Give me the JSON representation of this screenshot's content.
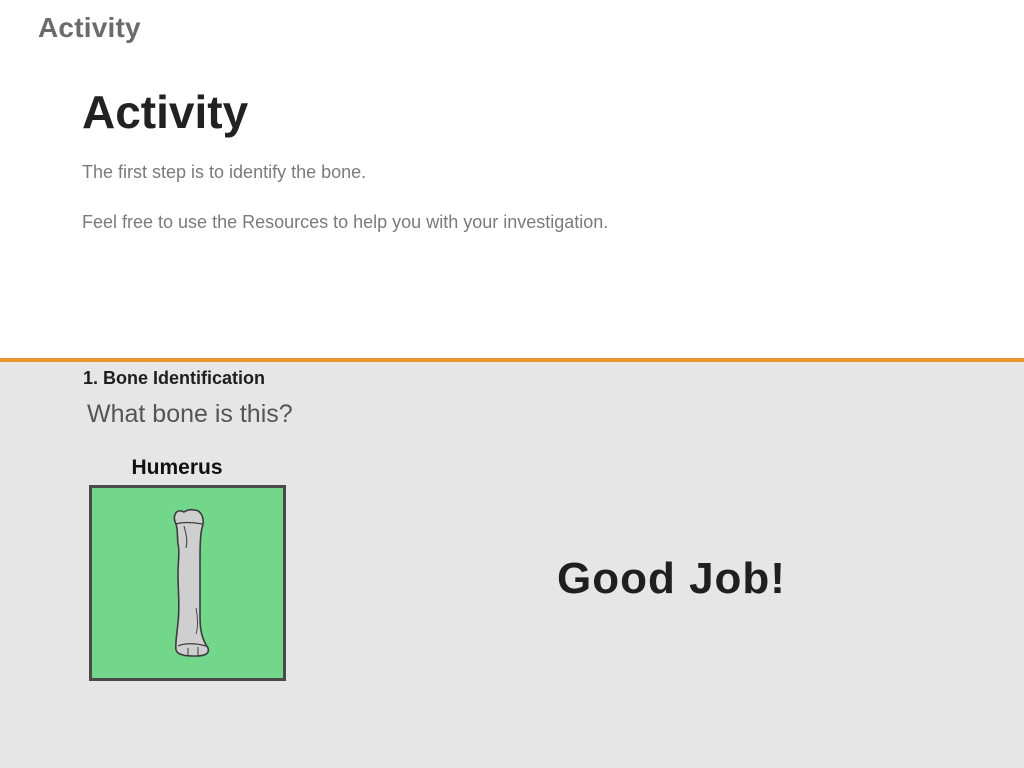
{
  "app": {
    "title": "Activity"
  },
  "intro": {
    "heading": "Activity",
    "paragraphs": [
      "The first step is to identify the bone.",
      "Feel free to use the Resources to help you with your investigation."
    ]
  },
  "question": {
    "header": "1. Bone Identification",
    "prompt": "What bone is this?",
    "selected_answer": {
      "label": "Humerus",
      "icon": "bone-icon",
      "state": "correct"
    },
    "feedback": "Good Job!"
  },
  "colors": {
    "accent_bar": "#e8952e",
    "correct_tile": "#72d78b",
    "panel_bg": "#e6e6e6",
    "tile_border": "#4a4a4a"
  }
}
